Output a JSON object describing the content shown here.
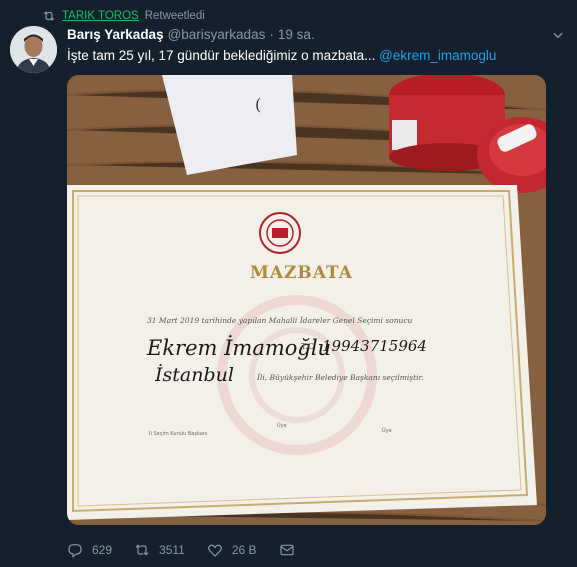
{
  "retweet": {
    "user": "TARIK TOROS",
    "label": "Retweetledi"
  },
  "tweet": {
    "author_name": "Barış Yarkadaş",
    "author_handle": "@barisyarkadas",
    "separator": "·",
    "time": "19 sa.",
    "text": "İşte tam 25 yıl, 17 gündür beklediğimiz o mazbata... ",
    "mention": "@ekrem_imamoglu"
  },
  "document": {
    "title": "MAZBATA",
    "line1": "31 Mart 2019 tarihinde yapılan Mahalli İdareler Genel Seçimi sonucu",
    "handwritten_name": "Ekrem İmamoğlu",
    "tc_label": "T.C.",
    "tc_number": "19943715964",
    "handwritten_city": "İstanbul",
    "line3": "İli, Büyükşehir Belediye Başkanı seçilmiştir.",
    "sig_chair": "İl Seçim Kurulu Başkanı",
    "sig_member1": "Üye",
    "sig_member2": "Üye",
    "seal_text": "YÜKSEK SEÇİM KURULU"
  },
  "actions": {
    "reply_count": "629",
    "retweet_count": "3511",
    "like_count": "26 B"
  },
  "colors": {
    "background": "#14202c",
    "secondary_text": "#8899a6",
    "link": "#1da1f2",
    "retweet_green": "#17bf63"
  },
  "icons": [
    "retweet-icon",
    "chevron-down-icon",
    "reply-icon",
    "like-icon",
    "message-icon"
  ]
}
